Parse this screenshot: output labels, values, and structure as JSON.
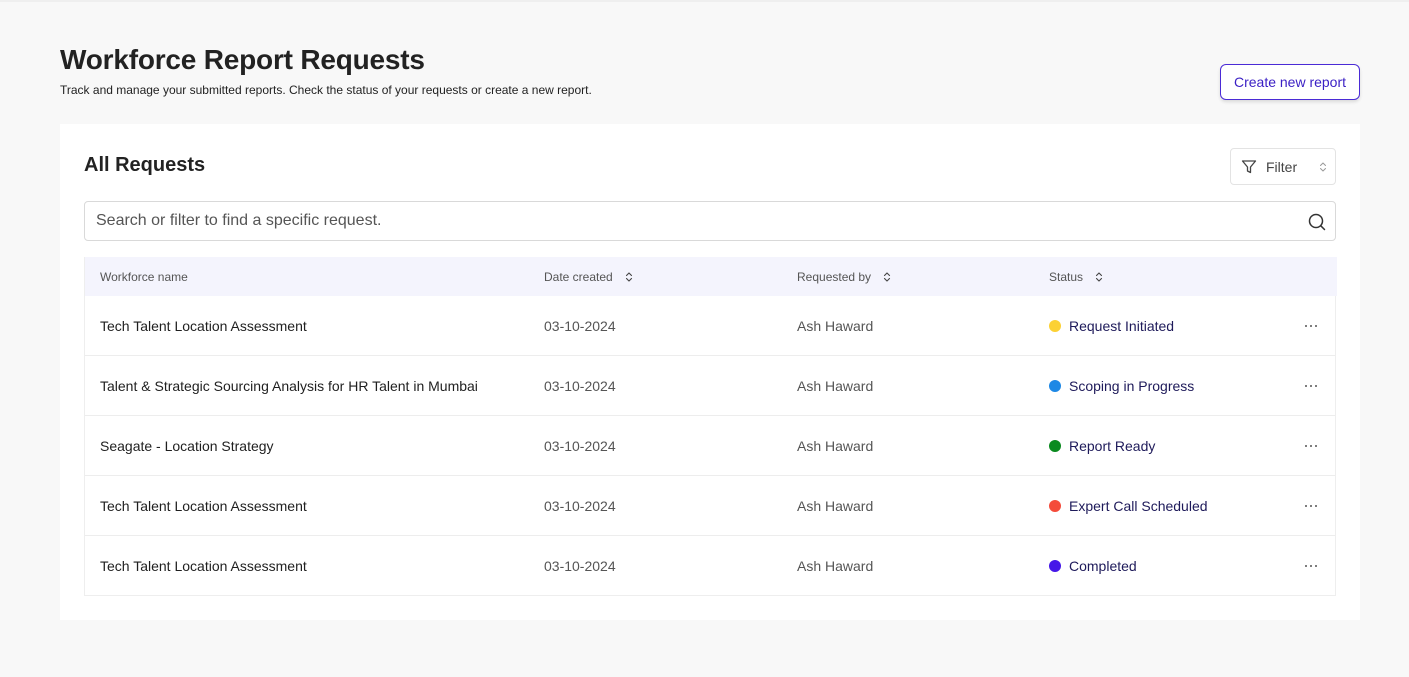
{
  "header": {
    "title": "Workforce Report Requests",
    "subtitle": "Track and manage your submitted reports. Check the status of your requests or create a new report.",
    "create_label": "Create new report"
  },
  "card": {
    "title": "All Requests",
    "filter_label": "Filter",
    "search_placeholder": "Search or filter to find a specific request."
  },
  "table": {
    "columns": [
      "Workforce name",
      "Date created",
      "Requested by",
      "Status"
    ],
    "rows": [
      {
        "name": "Tech Talent Location Assessment",
        "date": "03-10-2024",
        "requested_by": "Ash Haward",
        "status": "Request Initiated",
        "status_color": "#fcd134"
      },
      {
        "name": "Talent & Strategic Sourcing Analysis for HR Talent in Mumbai",
        "date": "03-10-2024",
        "requested_by": "Ash Haward",
        "status": "Scoping in Progress",
        "status_color": "#1e88e5"
      },
      {
        "name": "Seagate - Location Strategy",
        "date": "03-10-2024",
        "requested_by": "Ash Haward",
        "status": "Report Ready",
        "status_color": "#0b8a1f"
      },
      {
        "name": "Tech Talent Location Assessment",
        "date": "03-10-2024",
        "requested_by": "Ash Haward",
        "status": "Expert Call Scheduled",
        "status_color": "#f44b3a"
      },
      {
        "name": "Tech Talent Location Assessment",
        "date": "03-10-2024",
        "requested_by": "Ash Haward",
        "status": "Completed",
        "status_color": "#4517e8"
      }
    ]
  },
  "icons": {
    "filter": "filter-icon",
    "search": "search-icon",
    "sort": "sort-icon",
    "more": "more-horizontal-icon"
  },
  "colors": {
    "accent": "#4b2bd6",
    "table_header_bg": "#f4f4fd",
    "page_bg": "#f8f8f8"
  }
}
